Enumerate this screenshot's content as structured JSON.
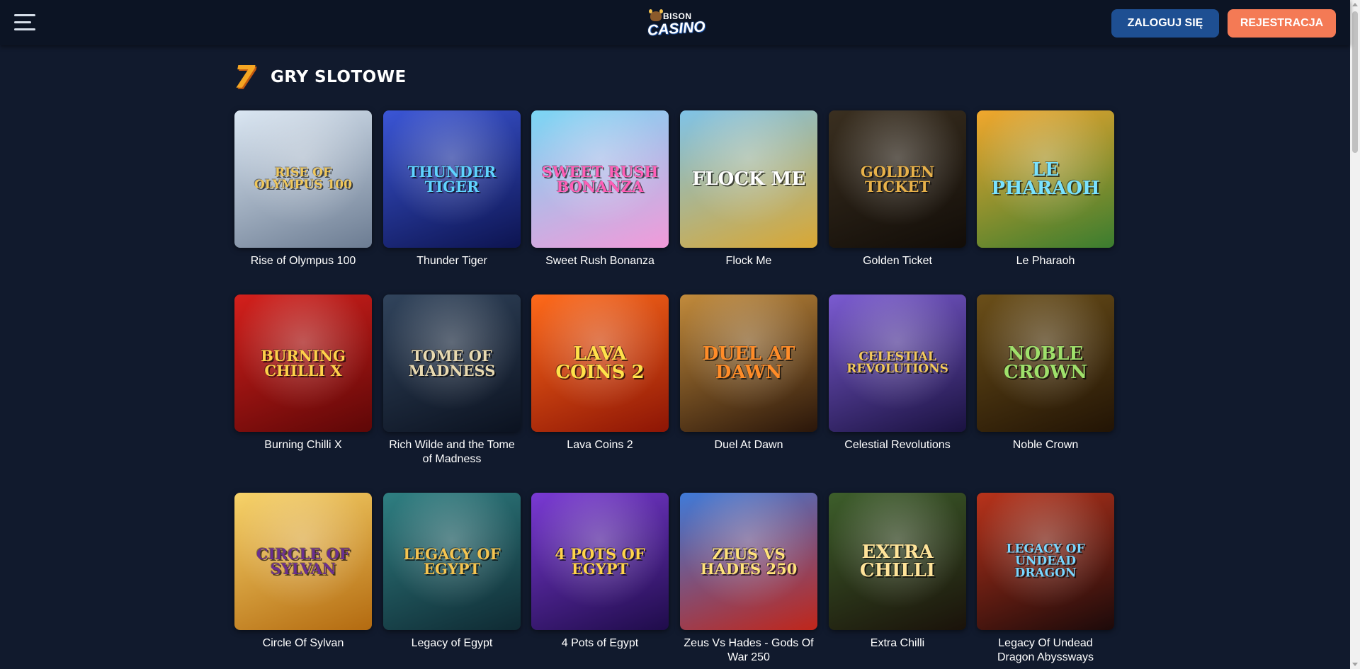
{
  "header": {
    "logo_top": "BISON",
    "logo_bottom": "CASINO",
    "login_label": "ZALOGUJ SIĘ",
    "register_label": "REJESTRACJA",
    "login_color": "#1e4f92",
    "register_color": "#f47a55"
  },
  "section": {
    "icon": "seven-icon",
    "icon_glyph": "7",
    "title": "GRY SLOTOWE"
  },
  "games": [
    {
      "name": "Rise of Olympus 100",
      "art": "RISE OF OLYMPUS 100",
      "bg1": "#dbe7f3",
      "bg2": "#6c7c92",
      "ink": "#f0c75a"
    },
    {
      "name": "Thunder Tiger",
      "art": "THUNDER TIGER",
      "bg1": "#3b56d6",
      "bg2": "#0d1450",
      "ink": "#5fd3ff"
    },
    {
      "name": "Sweet Rush Bonanza",
      "art": "SWEET RUSH BONANZA",
      "bg1": "#7ad6f4",
      "bg2": "#f29ad9",
      "ink": "#ff5fb7"
    },
    {
      "name": "Flock Me",
      "art": "FLOCK ME",
      "bg1": "#7fc3e8",
      "bg2": "#d9a733",
      "ink": "#ffffff"
    },
    {
      "name": "Golden Ticket",
      "art": "GOLDEN TICKET",
      "bg1": "#3a2f20",
      "bg2": "#120d08",
      "ink": "#e7b14a"
    },
    {
      "name": "Le Pharaoh",
      "art": "LE PHARAOH",
      "bg1": "#f1a72d",
      "bg2": "#3a7d2f",
      "ink": "#79e2ff"
    },
    {
      "name": "Burning Chilli X",
      "art": "BURNING CHILLI X",
      "bg1": "#d4201c",
      "bg2": "#5e0707",
      "ink": "#ffd14a"
    },
    {
      "name": "Rich Wilde and the Tome of Madness",
      "art": "TOME OF MADNESS",
      "bg1": "#31445c",
      "bg2": "#0b1220",
      "ink": "#e8d9b0"
    },
    {
      "name": "Lava Coins 2",
      "art": "LAVA COINS 2",
      "bg1": "#ff6a1a",
      "bg2": "#8d1505",
      "ink": "#ffe14a"
    },
    {
      "name": "Duel At Dawn",
      "art": "DUEL AT DAWN",
      "bg1": "#c28b3c",
      "bg2": "#2a160a",
      "ink": "#ff8c28"
    },
    {
      "name": "Celestial Revolutions",
      "art": "CELESTIAL REVOLUTIONS",
      "bg1": "#7b5bd1",
      "bg2": "#1a1240",
      "ink": "#f3c95b"
    },
    {
      "name": "Noble Crown",
      "art": "NOBLE CROWN",
      "bg1": "#6b4f19",
      "bg2": "#221405",
      "ink": "#9fe06b"
    },
    {
      "name": "Circle Of Sylvan",
      "art": "CIRCLE OF SYLVAN",
      "bg1": "#f7d36a",
      "bg2": "#b36a10",
      "ink": "#6a2f8f"
    },
    {
      "name": "Legacy of Egypt",
      "art": "LEGACY OF EGYPT",
      "bg1": "#2f7f82",
      "bg2": "#0f2a33",
      "ink": "#f4c451"
    },
    {
      "name": "4 Pots of Egypt",
      "art": "4 POTS OF EGYPT",
      "bg1": "#7a3ad4",
      "bg2": "#1f0c4a",
      "ink": "#ffd34a"
    },
    {
      "name": "Zeus Vs Hades - Gods Of War 250",
      "art": "ZEUS VS HADES 250",
      "bg1": "#3f7bd9",
      "bg2": "#c0261a",
      "ink": "#ffe27a"
    },
    {
      "name": "Extra Chilli",
      "art": "EXTRA CHILLI",
      "bg1": "#3d5e2b",
      "bg2": "#1a120a",
      "ink": "#ffe49a"
    },
    {
      "name": "Legacy Of Undead Dragon Abyssways",
      "art": "LEGACY OF UNDEAD DRAGON",
      "bg1": "#b8331b",
      "bg2": "#1c0a0a",
      "ink": "#79d6ff"
    }
  ]
}
